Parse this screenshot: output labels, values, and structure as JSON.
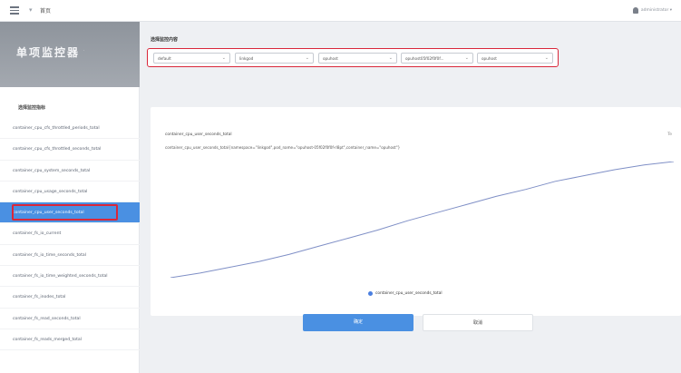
{
  "topbar": {
    "sep": "▾",
    "crumb": "首页",
    "user": "administrator ▾"
  },
  "sidebar": {
    "brand_title": "单项监控器",
    "brand_sub": "·",
    "metric_heading": "选择监控指标",
    "items": [
      {
        "label": "container_cpu_cfs_throttled_periods_total"
      },
      {
        "label": "container_cpu_cfs_throttled_seconds_total"
      },
      {
        "label": "container_cpu_system_seconds_total"
      },
      {
        "label": "container_cpu_usage_seconds_total"
      },
      {
        "label": "container_cpu_user_seconds_total"
      },
      {
        "label": "container_fs_io_current"
      },
      {
        "label": "container_fs_io_time_seconds_total"
      },
      {
        "label": "container_fs_io_time_weighted_seconds_total"
      },
      {
        "label": "container_fs_inodes_total"
      },
      {
        "label": "container_fs_read_seconds_total"
      },
      {
        "label": "container_fs_reads_merged_total"
      }
    ],
    "active_index": 4
  },
  "selectors": {
    "label": "选择监控内容",
    "items": [
      {
        "value": "default"
      },
      {
        "value": "linkgod"
      },
      {
        "value": "opuhost"
      },
      {
        "value": "opuhost05f02f0f0f..."
      },
      {
        "value": "opuhost"
      }
    ]
  },
  "chart": {
    "metric_name": "container_cpu_user_seconds_total",
    "metric_full": "container_cpu_user_seconds_total{namespace=\"linkgod\",pod_name=\"opuhost-05f02f0f0f-rl8pt\",container_name=\"opuhost\"}",
    "card_action": "Te",
    "legend": "container_cpu_user_seconds_total"
  },
  "chart_data": {
    "type": "line",
    "series": [
      {
        "name": "container_cpu_user_seconds_total",
        "values": [
          0,
          4,
          9,
          14,
          20,
          27,
          34,
          41,
          49,
          56,
          63,
          70,
          76,
          83,
          88,
          93,
          97,
          100
        ]
      }
    ],
    "ylim": [
      0,
      100
    ],
    "xlabel": "",
    "ylabel": ""
  },
  "buttons": {
    "primary": "确定",
    "secondary": "取消"
  },
  "colors": {
    "accent": "#4a90e2",
    "highlight": "#d9273a",
    "line": "#7f8fc6"
  }
}
